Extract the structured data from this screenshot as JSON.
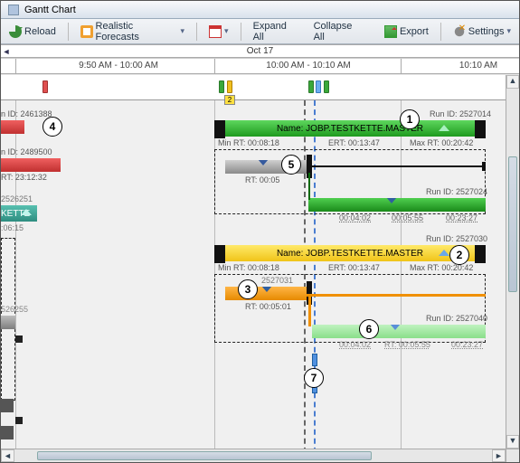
{
  "window": {
    "title": "Gantt Chart"
  },
  "toolbar": {
    "reload": "Reload",
    "forecasts": "Realistic Forecasts",
    "expand": "Expand All",
    "collapse": "Collapse All",
    "export": "Export",
    "settings": "Settings"
  },
  "header": {
    "date": "Oct 17",
    "slot_left": "9:50 AM - 10:00 AM",
    "slot_mid": "10:00 AM - 10:10 AM",
    "slot_right": "10:10 AM"
  },
  "overview": {
    "badge": "2"
  },
  "left_edge": {
    "runid_a": "n ID: 2461388",
    "runid_b": "n ID: 2489500",
    "rt_b": "RT: 23:12:32",
    "runid_c": "2526251",
    "kette": "KETTE",
    "kette_rt": ":06:15",
    "runid_d": "526255"
  },
  "group1": {
    "run": "Run ID: 2527014",
    "name": "Name: JOBP.TESTKETTE.MASTER",
    "min": "Min RT: 00:08:18",
    "ert": "ERT: 00:13:47",
    "max": "Max RT: 00:20:42",
    "child_rt": "RT: 00:05",
    "run2": "Run ID: 2527024",
    "info2a": "00:04:02",
    "info2b": "00:05:55",
    "info2c": "00:23:27"
  },
  "group2": {
    "run": "Run ID: 2527030",
    "name": "Name: JOBP.TESTKETTE.MASTER",
    "min": "Min RT: 00:08:18",
    "ert": "ERT: 00:13:47",
    "max": "Max RT: 00:20:42",
    "kid": "2527031",
    "child_rt": "RT: 00:05:01",
    "run2": "Run ID: 2527040",
    "info2a": "00:04:02",
    "info2b": "RT: 00:05:55",
    "info2c": "00:23:27"
  },
  "callouts": [
    "1",
    "2",
    "3",
    "4",
    "5",
    "6",
    "7"
  ],
  "chart_data": {
    "type": "gantt",
    "date": "Oct 17",
    "time_axis_minutes": {
      "visible_start": 587,
      "visible_end": 612
    },
    "current_time_marker_min": 603.5,
    "groups": [
      {
        "name": "JOBP.TESTKETTE.MASTER",
        "run_id": 2527014,
        "color": "green",
        "header_span_min": [
          600,
          614
        ],
        "stats": {
          "min_rt": "00:08:18",
          "ert": "00:13:47",
          "max_rt": "00:20:42"
        },
        "children": [
          {
            "run_id": null,
            "rt": "00:05",
            "span_min": [
              600,
              604
            ],
            "color": "gray"
          },
          {
            "run_id": 2527024,
            "rt": "00:05:55",
            "span_min": [
              604,
              614
            ],
            "color": "green",
            "info": {
              "a": "00:04:02",
              "c": "00:23:27"
            }
          }
        ]
      },
      {
        "name": "JOBP.TESTKETTE.MASTER",
        "run_id": 2527030,
        "color": "yellow",
        "header_span_min": [
          600,
          614
        ],
        "stats": {
          "min_rt": "00:08:18",
          "ert": "00:13:47",
          "max_rt": "00:20:42"
        },
        "children": [
          {
            "run_id": 2527031,
            "rt": "00:05:01",
            "span_min": [
              600,
              604
            ],
            "color": "orange"
          },
          {
            "run_id": 2527040,
            "rt": "00:05:55",
            "span_min": [
              604,
              614
            ],
            "color": "lightgreen",
            "info": {
              "a": "00:04:02",
              "c": "00:23:27"
            }
          }
        ]
      }
    ],
    "left_partial_bars": [
      {
        "run_id": 2461388,
        "color": "red"
      },
      {
        "run_id": 2489500,
        "color": "red",
        "rt": "23:12:32"
      },
      {
        "run_id": 2526251,
        "color": "gray"
      },
      {
        "label": "KETTE",
        "rt": "06:15",
        "color": "teal"
      },
      {
        "run_id": 526255,
        "color": "gray"
      }
    ]
  }
}
